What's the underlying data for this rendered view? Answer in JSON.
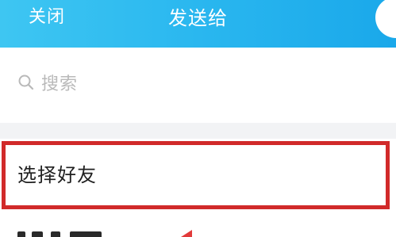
{
  "header": {
    "close_label": "关闭",
    "title": "发送给"
  },
  "search": {
    "placeholder": "搜索",
    "icon": "search-icon"
  },
  "list": {
    "select_friends_label": "选择好友"
  },
  "colors": {
    "header_bg": "#2ab7ef",
    "highlight_border": "#d12a2a",
    "page_bg": "#ffffff",
    "divider_bg": "#f2f3f5"
  }
}
